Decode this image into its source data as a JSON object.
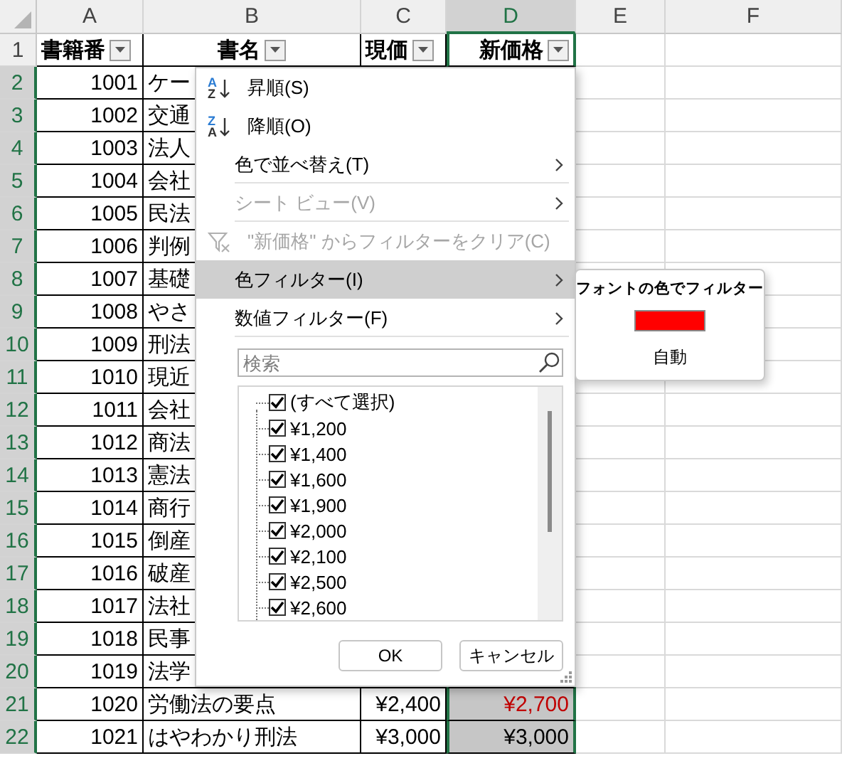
{
  "columns": [
    {
      "label": "A",
      "selected": false
    },
    {
      "label": "B",
      "selected": false
    },
    {
      "label": "C",
      "selected": false
    },
    {
      "label": "D",
      "selected": true
    },
    {
      "label": "E",
      "selected": false
    },
    {
      "label": "F",
      "selected": false
    }
  ],
  "header_row": {
    "number": "1",
    "selected": false,
    "cells": [
      {
        "text": "書籍番",
        "filter": true
      },
      {
        "text": "書名",
        "filter": true
      },
      {
        "text": "現価",
        "filter": true
      },
      {
        "text": "新価格",
        "filter": true
      }
    ]
  },
  "rows": [
    {
      "number": "2",
      "selected": true,
      "book_id": "1001",
      "title": "ケー"
    },
    {
      "number": "3",
      "selected": true,
      "book_id": "1002",
      "title": "交通"
    },
    {
      "number": "4",
      "selected": true,
      "book_id": "1003",
      "title": "法人"
    },
    {
      "number": "5",
      "selected": true,
      "book_id": "1004",
      "title": "会社"
    },
    {
      "number": "6",
      "selected": true,
      "book_id": "1005",
      "title": "民法"
    },
    {
      "number": "7",
      "selected": true,
      "book_id": "1006",
      "title": "判例"
    },
    {
      "number": "8",
      "selected": true,
      "book_id": "1007",
      "title": "基礎"
    },
    {
      "number": "9",
      "selected": true,
      "book_id": "1008",
      "title": "やさ"
    },
    {
      "number": "10",
      "selected": true,
      "book_id": "1009",
      "title": "刑法"
    },
    {
      "number": "11",
      "selected": true,
      "book_id": "1010",
      "title": "現近"
    },
    {
      "number": "12",
      "selected": true,
      "book_id": "1011",
      "title": "会社"
    },
    {
      "number": "13",
      "selected": true,
      "book_id": "1012",
      "title": "商法"
    },
    {
      "number": "14",
      "selected": true,
      "book_id": "1013",
      "title": "憲法"
    },
    {
      "number": "15",
      "selected": true,
      "book_id": "1014",
      "title": "商行"
    },
    {
      "number": "16",
      "selected": true,
      "book_id": "1015",
      "title": "倒産"
    },
    {
      "number": "17",
      "selected": true,
      "book_id": "1016",
      "title": "破産"
    },
    {
      "number": "18",
      "selected": true,
      "book_id": "1017",
      "title": "法社"
    },
    {
      "number": "19",
      "selected": true,
      "book_id": "1018",
      "title": "民事"
    },
    {
      "number": "20",
      "selected": true,
      "book_id": "1019",
      "title": "法学"
    },
    {
      "number": "21",
      "selected": true,
      "book_id": "1020",
      "title": "労働法の要点",
      "price": "¥2,400",
      "new_price": {
        "text": "¥2,700",
        "color": "#c00000"
      }
    },
    {
      "number": "22",
      "selected": true,
      "book_id": "1021",
      "title": "はやわかり刑法",
      "price": "¥3,000",
      "new_price": {
        "text": "¥3,000",
        "color": "#000000"
      }
    }
  ],
  "filter_menu": {
    "items": [
      {
        "kind": "sort",
        "label": "昇順(S)",
        "icon_top": "A",
        "icon_bottom": "Z",
        "disabled": false,
        "selected": false,
        "submenu": false,
        "separator_after": false
      },
      {
        "kind": "sort",
        "label": "降順(O)",
        "icon_top": "Z",
        "icon_bottom": "A",
        "disabled": false,
        "selected": false,
        "submenu": false,
        "separator_after": false
      },
      {
        "kind": "plain",
        "label": "色で並べ替え(T)",
        "disabled": false,
        "selected": false,
        "submenu": true,
        "separator_after": true
      },
      {
        "kind": "plain",
        "label": "シート ビュー(V)",
        "disabled": true,
        "selected": false,
        "submenu": true,
        "separator_after": true
      },
      {
        "kind": "clear",
        "label": "\"新価格\" からフィルターをクリア(C)",
        "disabled": true,
        "selected": false,
        "submenu": false,
        "separator_after": false
      },
      {
        "kind": "plain",
        "label": "色フィルター(I)",
        "disabled": false,
        "selected": true,
        "submenu": true,
        "separator_after": false
      },
      {
        "kind": "plain",
        "label": "数値フィルター(F)",
        "disabled": false,
        "selected": false,
        "submenu": true,
        "separator_after": true
      }
    ],
    "search": {
      "placeholder": "検索"
    },
    "values": [
      {
        "label": "(すべて選択)",
        "checked": true
      },
      {
        "label": "¥1,200",
        "checked": true
      },
      {
        "label": "¥1,400",
        "checked": true
      },
      {
        "label": "¥1,600",
        "checked": true
      },
      {
        "label": "¥1,900",
        "checked": true
      },
      {
        "label": "¥2,000",
        "checked": true
      },
      {
        "label": "¥2,100",
        "checked": true
      },
      {
        "label": "¥2,500",
        "checked": true
      },
      {
        "label": "¥2,600",
        "checked": true
      }
    ],
    "buttons": [
      "OK",
      "キャンセル"
    ]
  },
  "color_submenu": {
    "title": "フォントの色でフィルター",
    "swatches": [
      {
        "color": "#ff0000"
      }
    ],
    "items": [
      "自動"
    ]
  }
}
